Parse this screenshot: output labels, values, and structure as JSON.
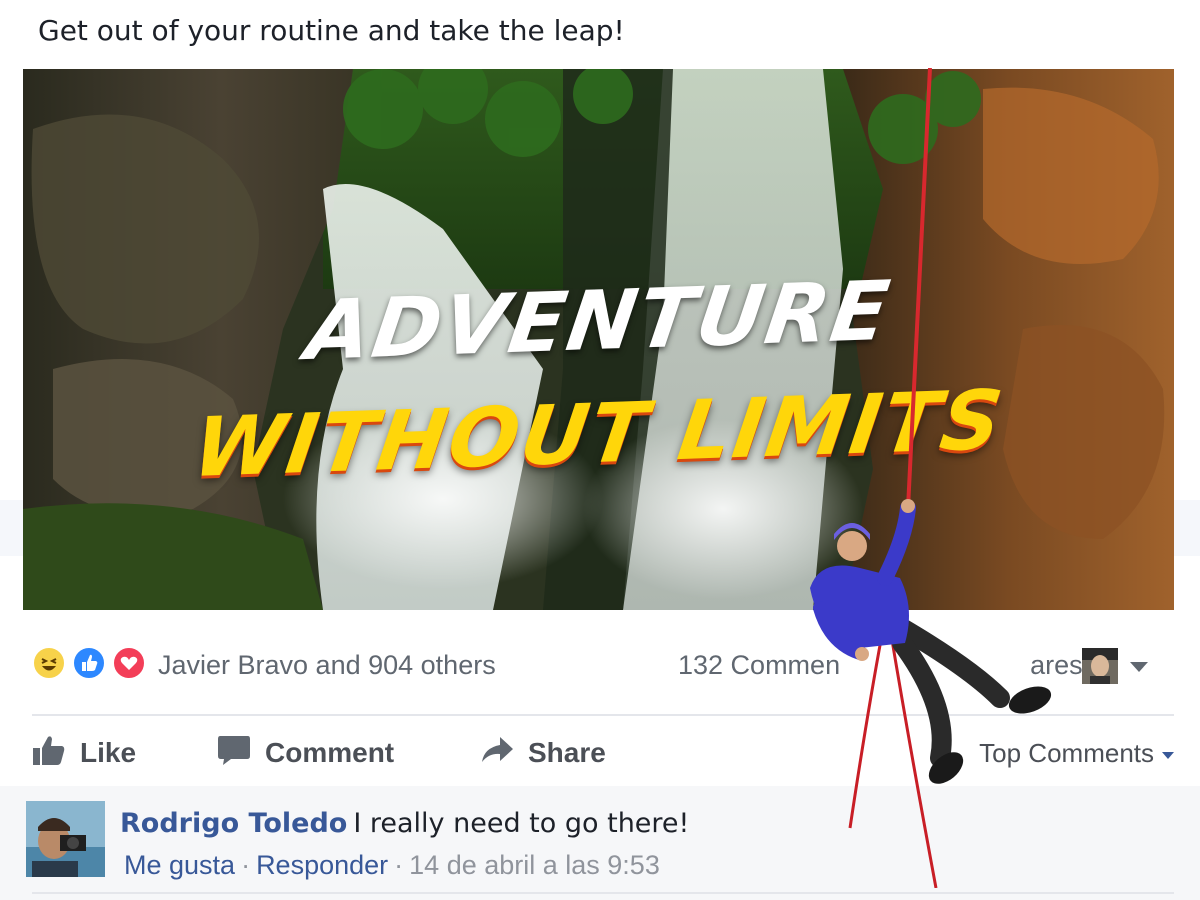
{
  "post": {
    "caption": "Get out of your routine and take the leap!",
    "image": {
      "headline_line1": "ADVENTURE",
      "headline_line2": "WITHOUT LIMITS"
    }
  },
  "reactions": {
    "icons": [
      "haha-icon",
      "like-icon",
      "love-icon"
    ],
    "likers_text": "Javier Bravo and 904 others",
    "counts_text": "132 Commen",
    "counts_text_after": "ares"
  },
  "actions": {
    "like_label": "Like",
    "comment_label": "Comment",
    "share_label": "Share",
    "sort_label": "Top Comments"
  },
  "comment": {
    "author": "Rodrigo Toledo",
    "text": "I really need to go there!",
    "like_link": "Me gusta",
    "reply_link": "Responder",
    "separator": "·",
    "timestamp": "14 de abril a las 9:53"
  },
  "colors": {
    "link_blue": "#385898",
    "meta_gray": "#90949c",
    "like_blue": "#2d88ff",
    "love_red": "#f33e58",
    "haha_yellow": "#f7d24a",
    "headline_yellow": "#ffd60a"
  }
}
